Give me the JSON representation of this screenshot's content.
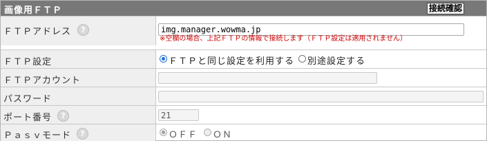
{
  "header": {
    "title": "画像用ＦＴＰ",
    "check_button": "接続確認"
  },
  "help_icon": "?",
  "rows": {
    "ftp_address": {
      "label": "ＦＴＰアドレス",
      "value": "img.manager.wowma.jp",
      "note": "※空欄の場合、上記ＦＴＰの情報で接続します（ＦＴＰ設定は適用されません）"
    },
    "ftp_setting": {
      "label": "ＦＴＰ設定",
      "options": [
        {
          "label": "ＦＴＰと同じ設定を利用する",
          "checked": true
        },
        {
          "label": "別途設定する",
          "checked": false
        }
      ]
    },
    "ftp_account": {
      "label": "ＦＴＰアカウント",
      "value": ""
    },
    "password": {
      "label": "パスワード",
      "value": ""
    },
    "port": {
      "label": "ポート番号",
      "value": "21"
    },
    "pasv_mode": {
      "label": "Ｐａｓｖモード",
      "options": [
        {
          "label": "ＯＦＦ",
          "checked": true
        },
        {
          "label": "ＯＮ",
          "checked": false
        }
      ]
    }
  },
  "colors": {
    "header_bg": "#787878",
    "label_bg": "#efefef",
    "note_text": "#cc0000",
    "radio_accent": "#1a6fd6"
  },
  "icons": {
    "help": "question-circle-icon",
    "radio": "radio-button"
  }
}
